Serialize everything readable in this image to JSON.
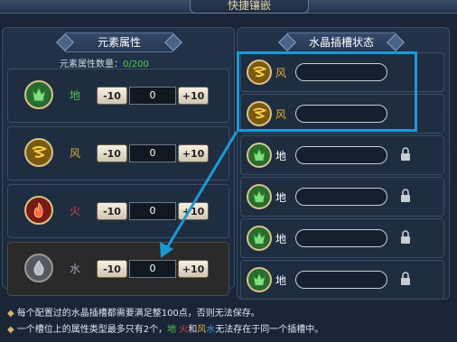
{
  "window": {
    "title": "快捷镶嵌"
  },
  "left_panel": {
    "title": "元素属性",
    "count_label": "元素属性数量：",
    "count_value": "0/200",
    "rows": [
      {
        "name": "地",
        "minus": "-10",
        "value": "0",
        "plus": "+10",
        "icon": "earth-icon"
      },
      {
        "name": "风",
        "minus": "-10",
        "value": "0",
        "plus": "+10",
        "icon": "wind-icon"
      },
      {
        "name": "火",
        "minus": "-10",
        "value": "0",
        "plus": "+10",
        "icon": "fire-icon"
      },
      {
        "name": "水",
        "minus": "-10",
        "value": "0",
        "plus": "+10",
        "icon": "water-icon"
      }
    ]
  },
  "right_panel": {
    "title": "水晶插槽状态",
    "slots": [
      {
        "name": "风",
        "locked": false,
        "icon": "wind-icon"
      },
      {
        "name": "风",
        "locked": false,
        "icon": "wind-icon"
      },
      {
        "name": "地",
        "locked": true,
        "icon": "earth-icon"
      },
      {
        "name": "地",
        "locked": true,
        "icon": "earth-icon"
      },
      {
        "name": "地",
        "locked": true,
        "icon": "earth-icon"
      },
      {
        "name": "地",
        "locked": true,
        "icon": "earth-icon"
      }
    ]
  },
  "notes": {
    "line1": "每个配置过的水晶插槽都需要满足整100点，否则无法保存。",
    "line2_a": "一个槽位上的属性类型最多只有2个，",
    "line2_earth": "地",
    "line2_fire": "火",
    "line2_and": "和",
    "line2_wind": "风",
    "line2_water": "水",
    "line2_b": "无法存在于同一个插槽中。"
  },
  "colors": {
    "earth": "#52c452",
    "wind": "#e0b030",
    "fire": "#e04040",
    "water": "#3aa2e0",
    "highlight": "#1a9ad6"
  }
}
